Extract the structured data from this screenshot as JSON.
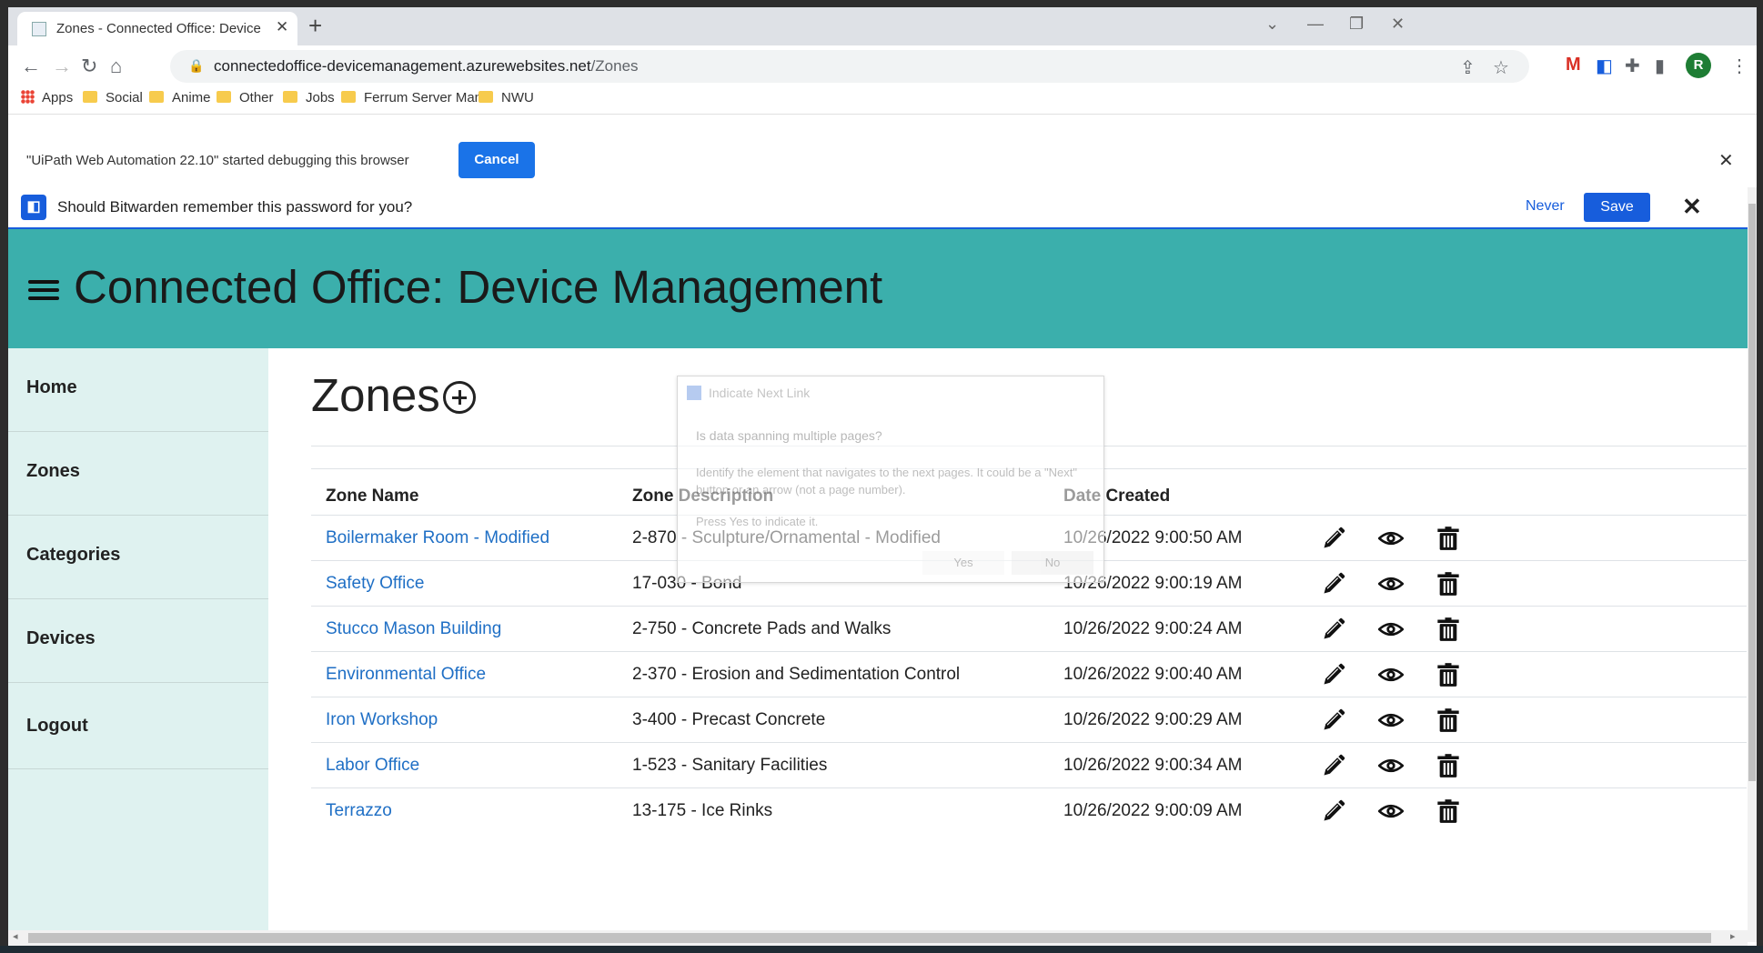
{
  "browser": {
    "tab_title": "Zones - Connected Office: Device",
    "url_host": "connectedoffice-devicemanagement.azurewebsites.net",
    "url_path": "/Zones",
    "profile_initial": "R"
  },
  "bookmarks": [
    {
      "label": "Apps",
      "icon": "apps-grid-icon"
    },
    {
      "label": "Social",
      "icon": "folder-icon"
    },
    {
      "label": "Anime",
      "icon": "folder-icon"
    },
    {
      "label": "Other",
      "icon": "folder-icon"
    },
    {
      "label": "Jobs",
      "icon": "folder-icon"
    },
    {
      "label": "Ferrum Server Man...",
      "icon": "folder-icon"
    },
    {
      "label": "NWU",
      "icon": "folder-icon"
    }
  ],
  "debug_bar": {
    "message": "\"UiPath Web Automation 22.10\" started debugging this browser",
    "cancel_label": "Cancel"
  },
  "bitwarden": {
    "message": "Should Bitwarden remember this password for you?",
    "never_label": "Never",
    "save_label": "Save"
  },
  "app": {
    "title": "Connected Office: Device Management",
    "accent_color": "#3bafac"
  },
  "sidebar": {
    "items": [
      {
        "label": "Home"
      },
      {
        "label": "Zones"
      },
      {
        "label": "Categories"
      },
      {
        "label": "Devices"
      },
      {
        "label": "Logout"
      }
    ]
  },
  "page": {
    "heading": "Zones",
    "columns": [
      "Zone Name",
      "Zone Description",
      "Date Created"
    ],
    "rows": [
      {
        "name": "Boilermaker Room - Modified",
        "description": "2-870 - Sculpture/Ornamental - Modified",
        "created": "10/26/2022 9:00:50 AM"
      },
      {
        "name": "Safety Office",
        "description": "17-030 - Bond",
        "created": "10/26/2022 9:00:19 AM"
      },
      {
        "name": "Stucco Mason Building",
        "description": "2-750 - Concrete Pads and Walks",
        "created": "10/26/2022 9:00:24 AM"
      },
      {
        "name": "Environmental Office",
        "description": "2-370 - Erosion and Sedimentation Control",
        "created": "10/26/2022 9:00:40 AM"
      },
      {
        "name": "Iron Workshop",
        "description": "3-400 - Precast Concrete",
        "created": "10/26/2022 9:00:29 AM"
      },
      {
        "name": "Labor Office",
        "description": "1-523 - Sanitary Facilities",
        "created": "10/26/2022 9:00:34 AM"
      },
      {
        "name": "Terrazzo",
        "description": "13-175 - Ice Rinks",
        "created": "10/26/2022 9:00:09 AM"
      }
    ]
  },
  "overlay": {
    "title": "Indicate Next Link",
    "question": "Is data spanning multiple pages?",
    "description": "Identify the element that navigates to the next pages. It could be a \"Next\" button or an arrow (not a page number).",
    "prompt": "Press Yes to indicate it.",
    "yes_label": "Yes",
    "no_label": "No"
  }
}
